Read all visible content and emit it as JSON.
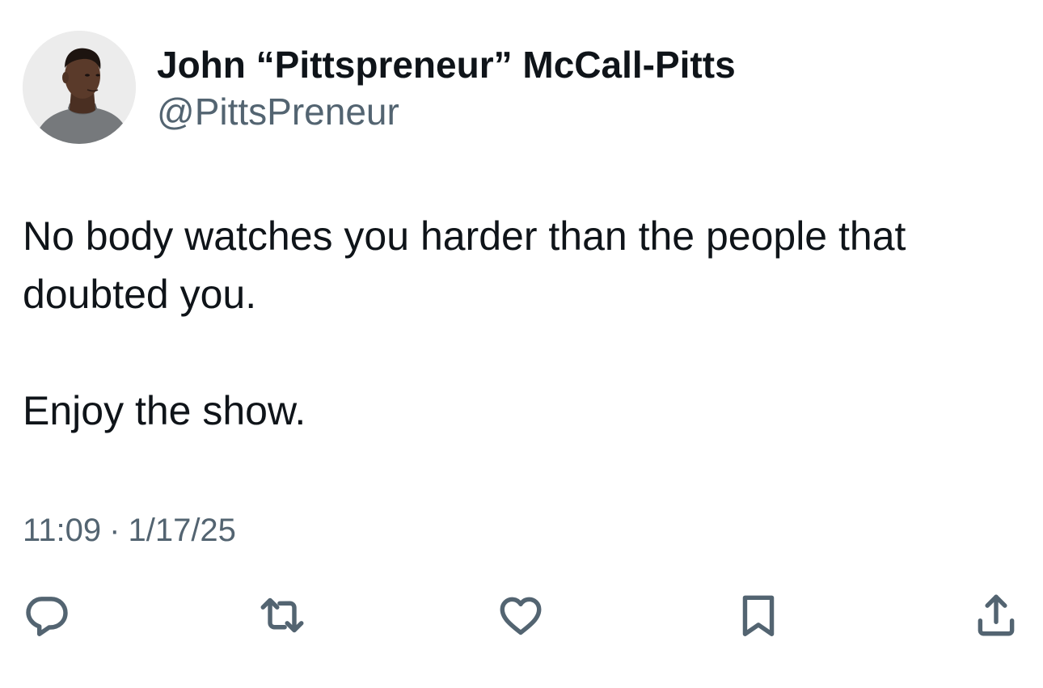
{
  "tweet": {
    "author": {
      "display_name": "John “Pittspreneur” McCall-Pitts",
      "handle": "@PittsPreneur",
      "avatar_icon": "profile-photo"
    },
    "text_paragraphs": [
      "No body watches you harder than the people that\ndoubted you.",
      "Enjoy the show."
    ],
    "time": "11:09",
    "separator": "·",
    "date": "1/17/25",
    "actions": [
      {
        "name": "reply",
        "icon": "speech-bubble-icon"
      },
      {
        "name": "retweet",
        "icon": "retweet-arrows-icon"
      },
      {
        "name": "like",
        "icon": "heart-icon"
      },
      {
        "name": "bookmark",
        "icon": "bookmark-icon"
      },
      {
        "name": "share",
        "icon": "share-upload-icon"
      }
    ],
    "colors": {
      "primary_text": "#0f1419",
      "secondary_text": "#536471",
      "background": "#ffffff"
    }
  }
}
